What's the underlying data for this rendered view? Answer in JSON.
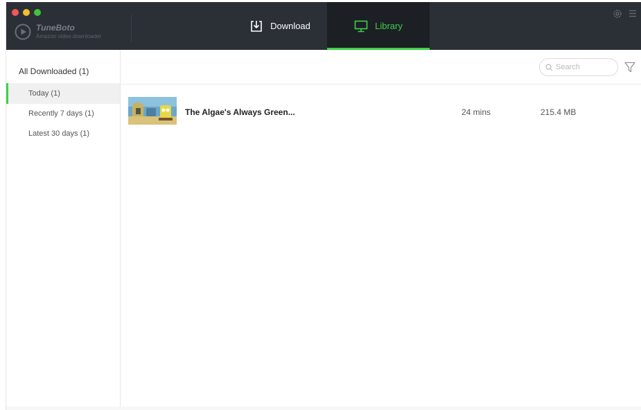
{
  "app": {
    "brand_name": "TuneBoto",
    "brand_subtitle": "Amazon video downloader"
  },
  "nav": {
    "tabs": [
      {
        "label": "Download",
        "icon": "download-icon",
        "active": false
      },
      {
        "label": "Library",
        "icon": "monitor-icon",
        "active": true
      }
    ]
  },
  "sidebar": {
    "header": "All Downloaded (1)",
    "items": [
      {
        "label": "Today (1)",
        "active": true
      },
      {
        "label": "Recently 7 days (1)",
        "active": false
      },
      {
        "label": "Latest 30 days (1)",
        "active": false
      }
    ]
  },
  "toolbar": {
    "search_placeholder": "Search"
  },
  "library": {
    "items": [
      {
        "title": "The Algae's Always Green...",
        "duration": "24 mins",
        "size": "215.4 MB"
      }
    ]
  },
  "colors": {
    "accent": "#3ed14a",
    "titlebar": "#2b2f36",
    "active_tab_bg": "#1c1f24"
  }
}
